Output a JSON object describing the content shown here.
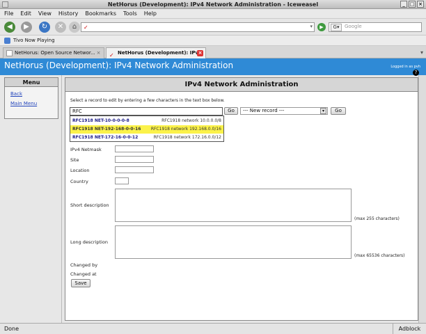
{
  "window": {
    "title": "NetHorus (Development): IPv4 Network Administration - Iceweasel"
  },
  "menubar": [
    "File",
    "Edit",
    "View",
    "History",
    "Bookmarks",
    "Tools",
    "Help"
  ],
  "urlbar": {
    "value": ""
  },
  "search": {
    "placeholder": "Google"
  },
  "bookmarks": [
    {
      "label": "Tivo Now Playing"
    }
  ],
  "tabs": [
    {
      "label": "NetHorus: Open Source Networ...",
      "active": false
    },
    {
      "label": "NetHorus (Development): IPv...",
      "active": true
    }
  ],
  "page": {
    "header": "NetHorus (Development): IPv4 Network Administration",
    "logged": "Logged in as pvh",
    "menu": {
      "title": "Menu",
      "items": [
        "Back",
        "Main Menu"
      ]
    },
    "panel": {
      "title": "IPv4 Network Administration",
      "instruction": "Select a record to edit by entering a few characters in the text box below.",
      "search_value": "RFC",
      "go": "Go",
      "new_record": "--- New record ---",
      "autocomplete": [
        {
          "name": "RFC1918 NET-10-0-0-0-8",
          "desc": "RFC1918 network 10.0.0.0/8",
          "highlighted": false
        },
        {
          "name": "RFC1918 NET-192-168-0-0-16",
          "desc": "RFC1918 network 192.168.0.0/16",
          "highlighted": true
        },
        {
          "name": "RFC1918 NET-172-16-0-0-12",
          "desc": "RFC1918 network 172.16.0.0/12",
          "highlighted": false
        }
      ],
      "fields": {
        "netmask": "IPv4 Netmask",
        "site": "Site",
        "location": "Location",
        "country": "Country",
        "short_desc": "Short description",
        "short_hint": "(max 255 characters)",
        "long_desc": "Long description",
        "long_hint": "(max 65536 characters)",
        "changed_by": "Changed by",
        "changed_at": "Changed at"
      },
      "save": "Save"
    }
  },
  "status": {
    "text": "Done",
    "adblock": "Adblock"
  }
}
